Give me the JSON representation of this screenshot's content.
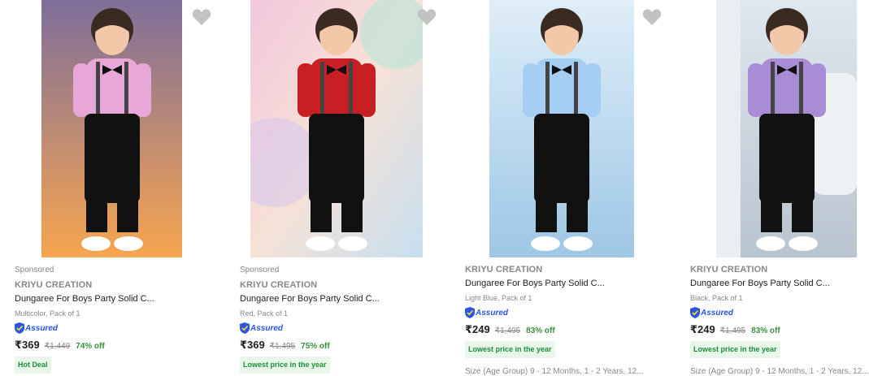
{
  "products": [
    {
      "sponsored": "Sponsored",
      "brand": "KRIYU CREATION",
      "title": "Dungaree For Boys Party Solid C...",
      "variant": "Multicolor, Pack of 1",
      "assured": "Assured",
      "price": "₹369",
      "mrp": "₹1,449",
      "discount": "74% off",
      "badge": "Hot Deal",
      "shirt_color": "#e7a7d9",
      "bg_top": "#7e6e9a",
      "bg_bottom": "#f7a54f"
    },
    {
      "sponsored": "Sponsored",
      "brand": "KRIYU CREATION",
      "title": "Dungaree For Boys Party Solid C...",
      "variant": "Red, Pack of 1",
      "assured": "Assured",
      "price": "₹369",
      "mrp": "₹1,495",
      "discount": "75% off",
      "badge": "Lowest price in the year",
      "shirt_color": "#c71f24",
      "bg_top": "#f3c7dd",
      "bg_bottom": "#c7dff0"
    },
    {
      "brand": "KRIYU CREATION",
      "title": "Dungaree For Boys Party Solid C...",
      "variant": "Light Blue, Pack of 1",
      "assured": "Assured",
      "price": "₹249",
      "mrp": "₹1,495",
      "discount": "83% off",
      "badge": "Lowest price in the year",
      "size_text": "Size (Age Group) 9 - 12 Months, 1 - 2 Years, 12...",
      "shirt_color": "#a6cdf2",
      "bg_top": "#dfeef8",
      "bg_bottom": "#9dc7e6"
    },
    {
      "brand": "KRIYU CREATION",
      "title": "Dungaree For Boys Party Solid C...",
      "variant": "Black, Pack of 1",
      "assured": "Assured",
      "price": "₹249",
      "mrp": "₹1,495",
      "discount": "83% off",
      "badge": "Lowest price in the year",
      "size_text": "Size (Age Group) 9 - 12 Months, 1 - 2 Years, 12...",
      "shirt_color": "#a98bd6",
      "bg_top": "#dfe7ef",
      "bg_bottom": "#b8c4cf"
    }
  ],
  "icons": {
    "wishlist": "heart-icon",
    "assured": "shield-icon"
  },
  "colors": {
    "discount": "#388e3c",
    "assured": "#2a55e5",
    "badge_bg": "#e8f7ea"
  }
}
